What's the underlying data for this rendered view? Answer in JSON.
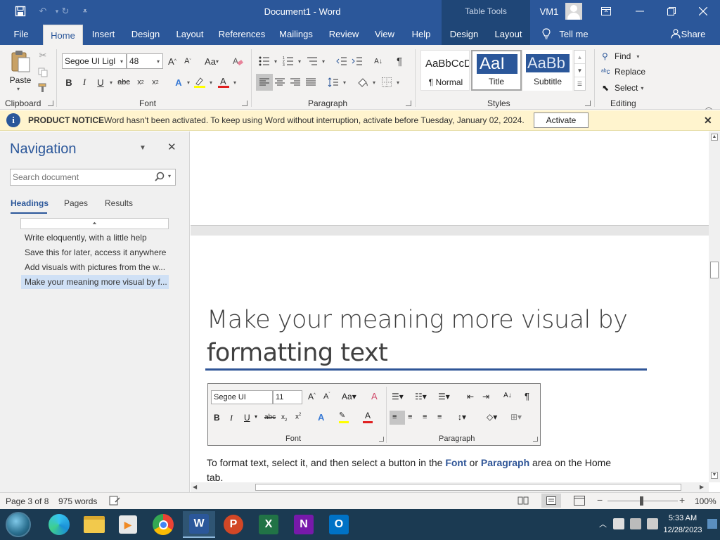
{
  "window": {
    "title": "Document1  -  Word",
    "contextual_tab": "Table Tools",
    "user": "VM1"
  },
  "menu_tabs": [
    "File",
    "Home",
    "Insert",
    "Design",
    "Layout",
    "References",
    "Mailings",
    "Review",
    "View",
    "Help",
    "Design",
    "Layout"
  ],
  "tell_me": "Tell me",
  "share": "Share",
  "ribbon": {
    "clipboard": {
      "label": "Clipboard",
      "paste": "Paste"
    },
    "font": {
      "label": "Font",
      "name": "Segoe UI Ligl",
      "size": "48",
      "aa": "Aa"
    },
    "paragraph": {
      "label": "Paragraph"
    },
    "styles": {
      "label": "Styles",
      "items": [
        {
          "preview": "AaBbCcD",
          "name": "¶ Normal"
        },
        {
          "preview": "AaI",
          "name": "Title"
        },
        {
          "preview": "AaBb",
          "name": "Subtitle"
        }
      ]
    },
    "editing": {
      "label": "Editing",
      "find": "Find",
      "replace": "Replace",
      "select": "Select"
    }
  },
  "notice": {
    "title": "PRODUCT NOTICE",
    "text": "Word hasn't been activated. To keep using Word without interruption, activate before Tuesday, January 02, 2024.",
    "button": "Activate"
  },
  "navigation": {
    "title": "Navigation",
    "search_placeholder": "Search document",
    "tabs": [
      "Headings",
      "Pages",
      "Results"
    ],
    "headings": [
      "Write eloquently, with a little help",
      "Save this for later, access it anywhere",
      "Add visuals with pictures from the w...",
      "Make your meaning more visual by f..."
    ]
  },
  "document": {
    "heading_line1": "Make your meaning more visual by",
    "heading_line2": "formatting text",
    "mini_ribbon": {
      "font_name": "Segoe UI",
      "font_size": "11",
      "font_label": "Font",
      "paragraph_label": "Paragraph",
      "aa": "Aa"
    },
    "body_prefix": "To format text, select it, and then select a button in the ",
    "body_font": "Font",
    "body_or": " or ",
    "body_paragraph": "Paragraph",
    "body_suffix": " area on the Home",
    "body_line2": "tab."
  },
  "status": {
    "page": "Page 3 of 8",
    "words": "975 words",
    "zoom": "100%"
  },
  "taskbar": {
    "time": "5:33 AM",
    "date": "12/28/2023"
  },
  "colors": {
    "accent": "#2b579a",
    "notice_bg": "#fff4ce",
    "heading_text": "#404040",
    "heading_rule": "#2f5597"
  }
}
